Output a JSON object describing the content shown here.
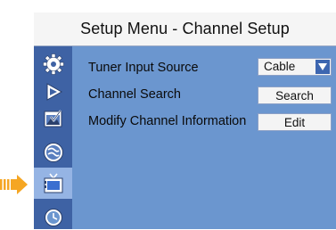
{
  "title": "Setup Menu - Channel Setup",
  "sidebar": {
    "items": [
      {
        "icon": "gear-icon",
        "active": false
      },
      {
        "icon": "play-icon",
        "active": false
      },
      {
        "icon": "picture-edit-icon",
        "active": false
      },
      {
        "icon": "sound-icon",
        "active": false
      },
      {
        "icon": "tv-icon",
        "active": true
      },
      {
        "icon": "clock-icon",
        "active": false
      }
    ]
  },
  "settings": {
    "tuner_input_source": {
      "label": "Tuner Input Source",
      "value": "Cable"
    },
    "channel_search": {
      "label": "Channel Search",
      "button": "Search"
    },
    "modify_channel_info": {
      "label": "Modify Channel Information",
      "button": "Edit"
    }
  },
  "colors": {
    "panel": "#6b96cf",
    "sidebar": "#3e62a4",
    "sidebar_active": "#95b4e4",
    "pointer": "#f5a623"
  }
}
